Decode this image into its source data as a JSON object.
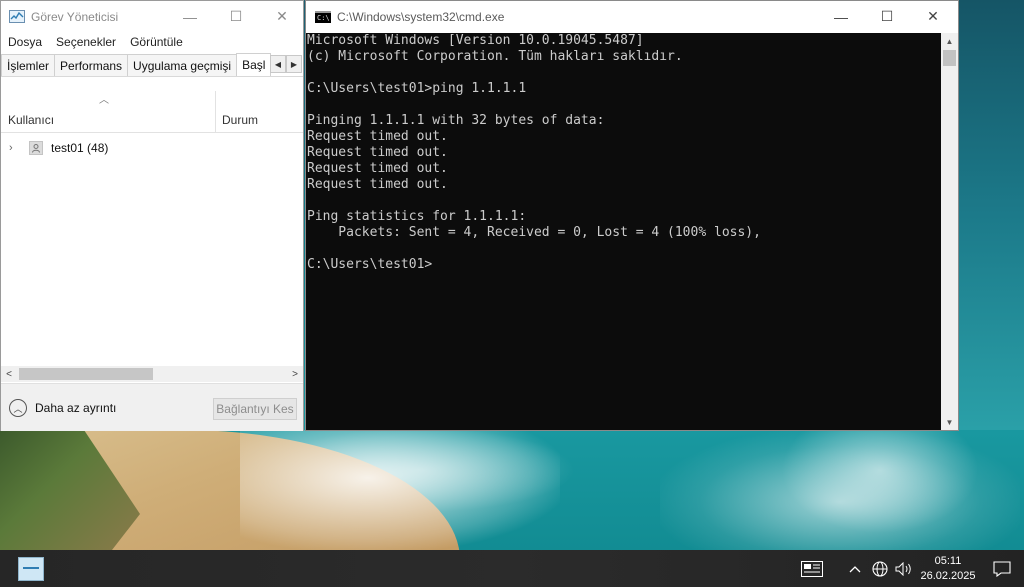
{
  "task_manager": {
    "title": "Görev Yöneticisi",
    "menu": [
      "Dosya",
      "Seçenekler",
      "Görüntüle"
    ],
    "tabs": [
      "İşlemler",
      "Performans",
      "Uygulama geçmişi",
      "Başl"
    ],
    "columns": {
      "user": "Kullanıcı",
      "status": "Durum"
    },
    "rows": [
      {
        "name": "test01 (48)"
      }
    ],
    "footer": {
      "less_details": "Daha az ayrıntı",
      "disconnect": "Bağlantıyı Kes"
    }
  },
  "cmd": {
    "title": "C:\\Windows\\system32\\cmd.exe",
    "lines": [
      "Microsoft Windows [Version 10.0.19045.5487]",
      "(c) Microsoft Corporation. Tüm hakları saklıdır.",
      "",
      "C:\\Users\\test01>ping 1.1.1.1",
      "",
      "Pinging 1.1.1.1 with 32 bytes of data:",
      "Request timed out.",
      "Request timed out.",
      "Request timed out.",
      "Request timed out.",
      "",
      "Ping statistics for 1.1.1.1:",
      "    Packets: Sent = 4, Received = 0, Lost = 4 (100% loss),",
      "",
      "C:\\Users\\test01>"
    ]
  },
  "taskbar": {
    "time": "05:11",
    "date": "26.02.2025"
  },
  "window_buttons": {
    "minimize": "—",
    "maximize": "☐",
    "close": "✕"
  }
}
